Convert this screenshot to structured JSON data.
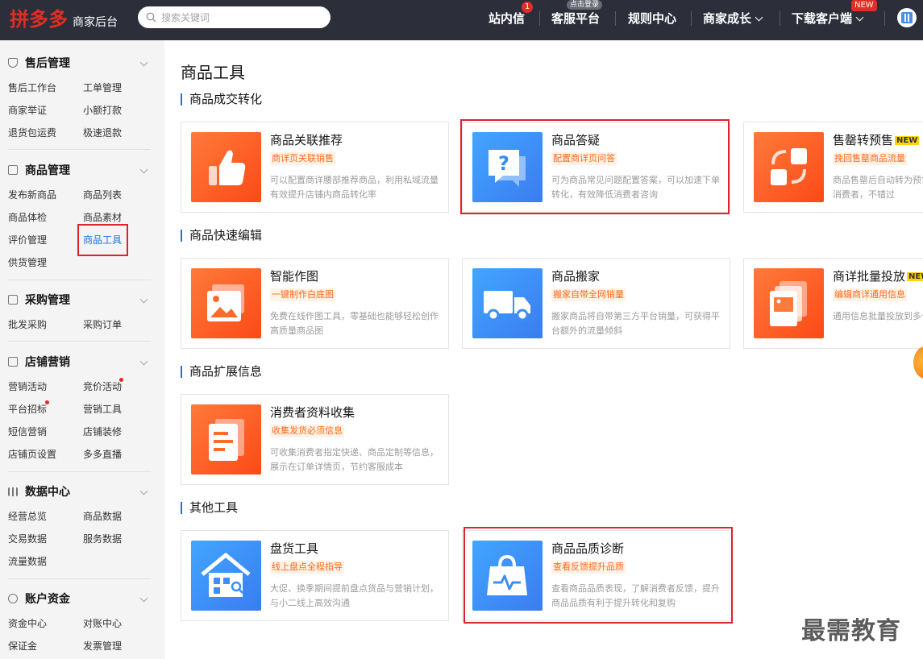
{
  "header": {
    "logo_main": "拼多多",
    "logo_sub": "商家后台",
    "search_placeholder": "搜索关键词",
    "nav": {
      "messages": "站内信",
      "messages_badge": "1",
      "service": "客服平台",
      "service_badge": "点击登录",
      "rules": "规则中心",
      "growth": "商家成长",
      "download": "下载客户端",
      "download_badge": "NEW"
    }
  },
  "sidebar": {
    "groups": [
      {
        "title": "售后管理",
        "icon": "shield-icon",
        "links": [
          "售后工作台",
          "工单管理",
          "商家举证",
          "小额打款",
          "退货包运费",
          "极速退款"
        ]
      },
      {
        "title": "商品管理",
        "icon": "goods-icon",
        "links": [
          "发布新商品",
          "商品列表",
          "商品体检",
          "商品素材",
          "评价管理",
          "商品工具",
          "供货管理"
        ]
      },
      {
        "title": "采购管理",
        "icon": "purchase-icon",
        "links": [
          "批发采购",
          "采购订单"
        ]
      },
      {
        "title": "店铺营销",
        "icon": "store-icon",
        "links": [
          "营销活动",
          "竞价活动",
          "平台招标",
          "营销工具",
          "短信营销",
          "店铺装修",
          "店铺页设置",
          "多多直播"
        ]
      },
      {
        "title": "数据中心",
        "icon": "chart-icon",
        "links": [
          "经营总览",
          "商品数据",
          "交易数据",
          "服务数据",
          "流量数据"
        ]
      },
      {
        "title": "账户资金",
        "icon": "yen-icon",
        "links": [
          "资金中心",
          "对账中心",
          "保证金",
          "发票管理"
        ]
      }
    ],
    "active": "商品工具"
  },
  "main": {
    "page_title": "商品工具",
    "sections": [
      {
        "title": "商品成交转化",
        "cards": [
          {
            "title": "商品关联推荐",
            "tag": "商详页关联销售",
            "desc": "可以配置商详腰部推荐商品，利用私域流量有效提升店铺内商品转化率",
            "icon": "thumbs-up-icon",
            "color": "orange"
          },
          {
            "title": "商品答疑",
            "tag": "配置商详页问答",
            "desc": "可为商品常见问题配置答案，可以加速下单转化，有效降低消费者咨询",
            "icon": "question-chat-icon",
            "color": "blue"
          },
          {
            "title": "售罄转预售",
            "badge": "NEW",
            "tag": "挽回售罄商品流量",
            "desc": "商品售罄后自动转为预售，不错过任何一个消费者，不错过",
            "icon": "refresh-grid-icon",
            "color": "orange"
          }
        ]
      },
      {
        "title": "商品快速编辑",
        "cards": [
          {
            "title": "智能作图",
            "tag": "一键制作白底图",
            "desc": "免费在线作图工具，零基础也能够轻松创作高质量商品图",
            "icon": "image-stack-icon",
            "color": "orange"
          },
          {
            "title": "商品搬家",
            "tag": "搬家自带全网销量",
            "desc": "搬家商品将自带第三方平台销量，可获得平台额外的流量倾斜",
            "icon": "truck-icon",
            "color": "blue"
          },
          {
            "title": "商详批量投放",
            "badge": "NEW",
            "tag": "编辑商详通用信息",
            "desc": "通用信息批量投放到多个商品，一次设置",
            "icon": "image-cards-icon",
            "color": "orange"
          }
        ]
      },
      {
        "title": "商品扩展信息",
        "cards": [
          {
            "title": "消费者资料收集",
            "tag": "收集发货必须信息",
            "desc": "可收集消费者指定快递、商品定制等信息，展示在订单详情页，节约客服成本",
            "icon": "document-icon",
            "color": "orange"
          }
        ]
      },
      {
        "title": "其他工具",
        "cards": [
          {
            "title": "盘货工具",
            "tag": "线上盘点全程指导",
            "desc": "大促、换季期间提前盘点货品与营销计划，与小二线上高效沟通",
            "icon": "house-search-icon",
            "color": "blue"
          },
          {
            "title": "商品品质诊断",
            "tag": "查看反馈提升品质",
            "desc": "查看商品品质表现，了解消费者反馈，提升商品品质有利于提升转化和复购",
            "icon": "bag-pulse-icon",
            "color": "blue"
          }
        ]
      }
    ]
  },
  "watermark": "最需教育",
  "colors": {
    "brand": "#e02e24",
    "accent": "#1a74e4",
    "highlight": "#d9252d",
    "tag": "#fc6a1c"
  }
}
